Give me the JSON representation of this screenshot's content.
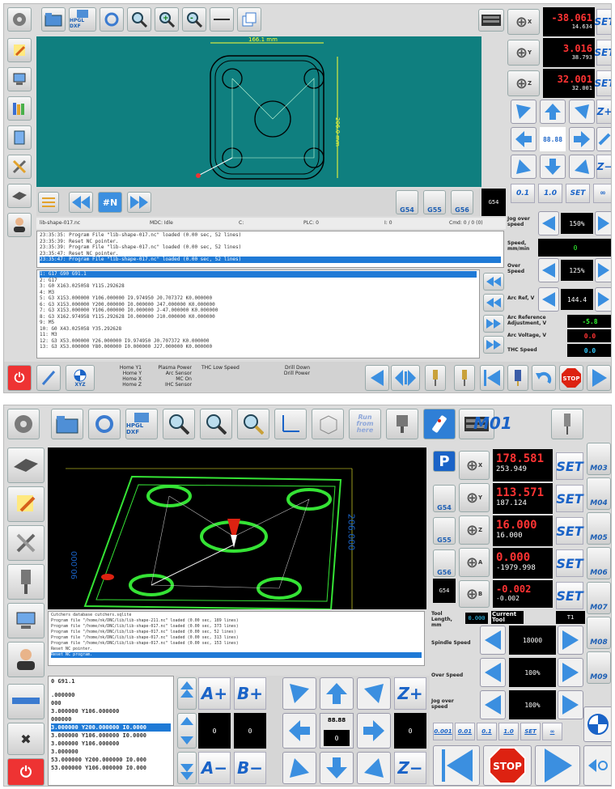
{
  "top": {
    "toolbar": {
      "hpgl_label": "HPGL DXF"
    },
    "drawing": {
      "width_dim": "166.1 mm",
      "height_dim": "206.0 mm"
    },
    "dro": {
      "x_value": "-38.061",
      "x_sub": "14.634",
      "y_value": "3.016",
      "y_sub": "38.793",
      "z_value": "32.001",
      "z_sub": "32.001",
      "set_label": "SET",
      "axis_x": "X",
      "axis_y": "Y",
      "axis_z": "Z"
    },
    "jog": {
      "speed_display": "88.88",
      "zplus": "Z+",
      "zminus": "Z−"
    },
    "step_buttons": [
      "0.1",
      "1.0",
      "SET",
      "∞"
    ],
    "wcs_buttons": [
      "G54",
      "G55",
      "G56"
    ],
    "wcs_current": "G54",
    "mid_nav": {
      "hash_n": "#N"
    },
    "status_bar": {
      "file": "lib-shape-017.nc",
      "mdc": "MDC: Idle",
      "c": "C:",
      "plc": "PLC: 0",
      "i": "I: 0",
      "cmd": "Cmd: 0 / 0 (0)"
    },
    "log_lines": [
      "23:35:35: Program File \"lib-shape-017.nc\" loaded (0.00 sec, 52 lines)",
      "23:35:39: Reset NC pointer.",
      "23:35:39: Program File \"lib-shape-017.nc\" loaded (0.00 sec, 52 lines)",
      "23:35:47: Reset NC pointer.",
      "23:35:47: Program File \"lib-shape-017.nc\" loaded (0.00 sec, 52 lines)"
    ],
    "gcode_lines": [
      "1: G17 G90 G91.1",
      "2: G17",
      "3: G0 X163.025058 Y115.292628",
      "4: M3",
      "5: G3 X153.000000 Y106.000000 I9.974950 J0.707372 K0.000000",
      "6: G3 X153.000000 Y200.000000 I0.000000 J47.000000 K0.000000",
      "7: G3 X153.000000 Y106.000000 I0.000000 J-47.000000 K0.000000",
      "8: G3 X162.974958 Y115.292628 I0.000000 J10.000000 K0.000000",
      "9: M5",
      "10: G0 X43.025058 Y35.292628",
      "11: M3",
      "12: G3 X53.000000 Y26.000000 I9.974950 J0.707372 K0.000000",
      "13: G3 X53.000000 Y80.000000 I0.000000 J27.000000 K0.000000"
    ],
    "right_params": {
      "jog_over_speed_label": "Jog over speed",
      "jog_over_speed_value": "150%",
      "speed_label": "Speed, mm/min",
      "speed_value": "0",
      "over_speed_label": "Over Speed",
      "over_speed_value": "125%",
      "arc_ref_label": "Arc Ref, V",
      "arc_ref_value": "144.4",
      "arc_adj_label": "Arc Reference Adjustment, V",
      "arc_adj_value": "-5.8",
      "arc_voltage_label": "Arc Voltage, V",
      "arc_voltage_value": "0.0",
      "thc_speed_label": "THC Speed",
      "thc_speed_value": "0.0"
    },
    "bottom_status": {
      "home_y1": "Home Y1",
      "home_y": "Home Y",
      "home_x": "Home X",
      "home_z": "Home Z",
      "plasma_power": "Plasma Power",
      "arc_sensor": "Arc Sensor",
      "mc_on": "MC On",
      "ihc_sensor": "IHC Sensor",
      "thc_low_speed": "THC Low Speed",
      "drill_down": "Drill Down",
      "drill_power": "Drill Power",
      "xyz": "XYZ",
      "stop": "STOP"
    }
  },
  "bottom": {
    "toolbar": {
      "hpgl_label": "HPGL DXF",
      "run_from_here": "Run from here",
      "m01": "M01"
    },
    "view3d": {
      "dim_right": "206.000",
      "dim_left": "90.000"
    },
    "wcs_buttons": [
      "G54",
      "G55",
      "G56"
    ],
    "wcs_current": "G54",
    "parking": "P",
    "dro": {
      "x_value": "178.581",
      "x_sub": "253.949",
      "y_value": "113.571",
      "y_sub": "187.124",
      "z_value": "16.000",
      "z_sub": "16.000",
      "a_value": "0.000",
      "a_sub": "-1979.998",
      "b_value": "-0.002",
      "b_sub": "-0.002",
      "set_label": "SET",
      "axis_x": "X",
      "axis_y": "Y",
      "axis_z": "Z",
      "axis_a": "A",
      "axis_b": "B"
    },
    "m_codes": [
      "M03",
      "M04",
      "M05",
      "M06",
      "M07",
      "M08",
      "M09"
    ],
    "tool": {
      "length_label": "Tool Length, mm",
      "length_value": "0.000",
      "current_label": "Current Tool",
      "current_value": "T1"
    },
    "params": {
      "spindle_speed_label": "Spindle Speed",
      "spindle_speed_value": "18000",
      "over_speed_label": "Over Speed",
      "over_speed_value": "100%",
      "jog_over_speed_label": "Jog over speed",
      "jog_over_speed_value": "100%"
    },
    "step_buttons": [
      "0.001",
      "0.01",
      "0.1",
      "1.0",
      "SET",
      "∞"
    ],
    "log_lines": [
      "Cutchers database cutchers.sqlite",
      "Program file \"/home/nk/DNC/lib/lib-shape-211.nc\" loaded (0.00 sec, 189 lines)",
      "Program file \"/home/nk/DNC/lib/lib-shape-017.nc\" loaded (0.00 sec, 373 lines)",
      "Program file \"/home/nk/DNC/lib/lib-shape-017.nc\" loaded (0.00 sec, 52 lines)",
      "Program file \"/home/nk/DNC/lib/lib-shape-017.nc\" loaded (0.00 sec, 313 lines)",
      "Program file \"/home/nk/DNC/lib/lib-shape-017.nc\" loaded (0.00 sec, 153 lines)",
      "Reset NC pointer.",
      "Reset NC program."
    ],
    "gcode_lines": [
      "0 G91.1",
      "",
      ".000000",
      "000",
      "3.000000 Y106.000000",
      "000000",
      "3.000000 Y200.000000 I0.0000",
      "3.000000 Y106.000000 I0.0000",
      "3.000000 Y106.000000",
      "3.000000",
      "53.000000 Y200.000000 I0.000",
      "53.000000 Y106.000000 I0.000"
    ],
    "jog": {
      "a_plus": "A+",
      "b_plus": "B+",
      "a_minus": "A−",
      "b_minus": "B−",
      "z_plus": "Z+",
      "z_minus": "Z−",
      "speed_value": "88.88",
      "left_value_1": "0",
      "left_value_2": "0",
      "center_value": "0",
      "right_value": "0"
    },
    "stop": "STOP"
  },
  "colors": {
    "viewport_top": "#0f7f7f",
    "viewport_bottom": "#000000",
    "accent_blue": "#1a63c7",
    "highlight": "#1f7ad6",
    "dro_red": "#ff3333",
    "toolpath_green": "#35e335"
  }
}
